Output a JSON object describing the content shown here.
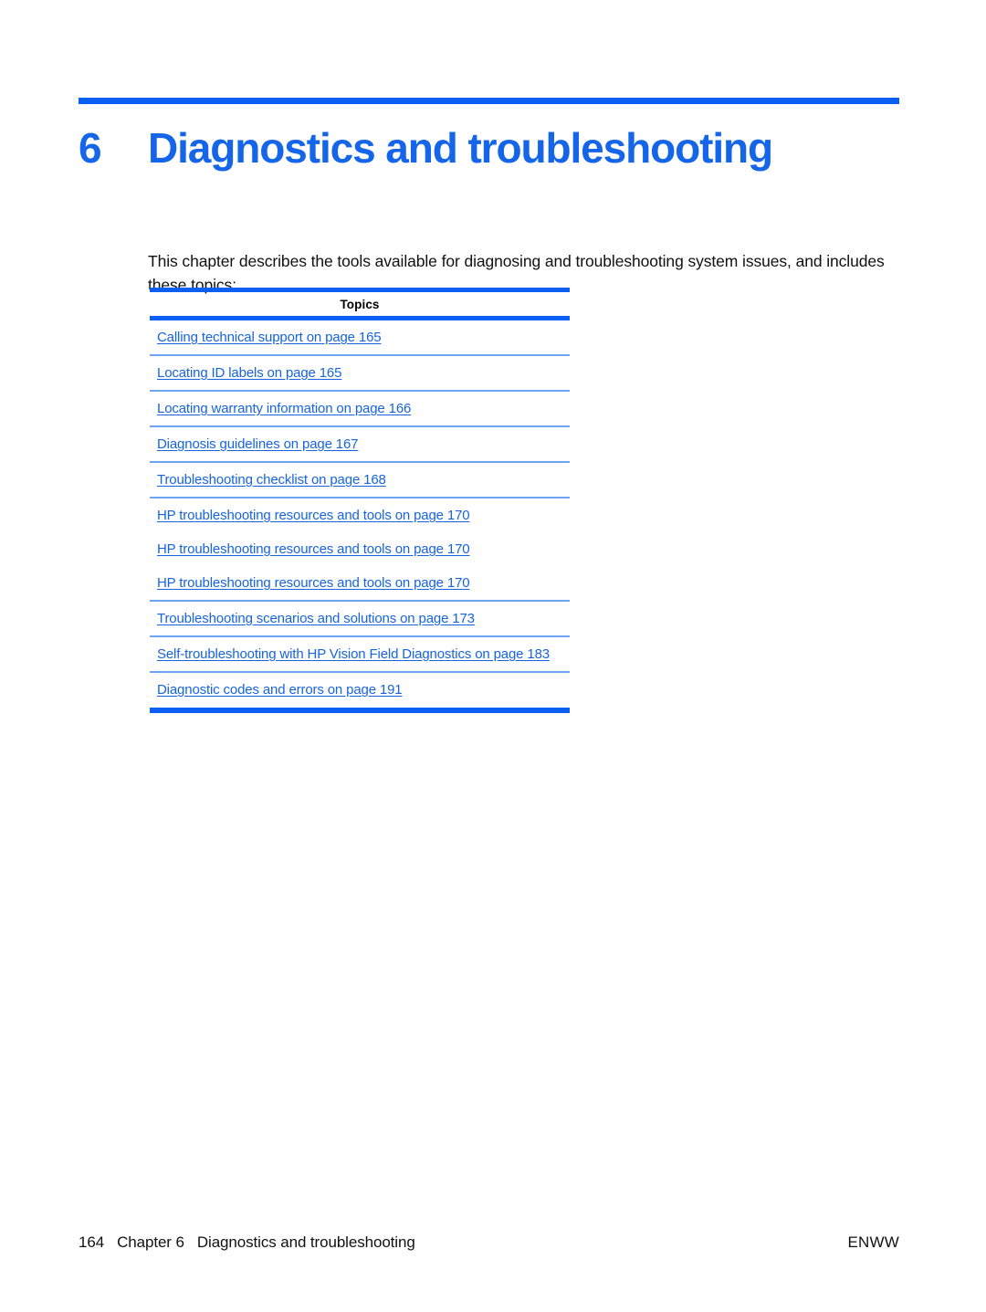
{
  "document": {
    "chapter_number": "6",
    "chapter_title": "Diagnostics and troubleshooting",
    "intro": "This chapter describes the tools available for diagnosing and troubleshooting system issues, and includes these topics:",
    "accent_color": "#0A5FF5",
    "heading_color": "#1565E8",
    "link_color": "#1764E0",
    "rule_light_color": "#6FA4F2"
  },
  "topics_table": {
    "header": "Topics",
    "rows": [
      {
        "label": "Calling technical support on page 165",
        "separator": true
      },
      {
        "label": "Locating ID labels on page 165",
        "separator": true
      },
      {
        "label": "Locating warranty information on page 166",
        "separator": true
      },
      {
        "label": "Diagnosis guidelines on page 167",
        "separator": true
      },
      {
        "label": "Troubleshooting checklist on page 168",
        "separator": true
      },
      {
        "label": "HP troubleshooting resources and tools on page 170",
        "separator": false
      },
      {
        "label": "HP troubleshooting resources and tools on page 170",
        "separator": false
      },
      {
        "label": "HP troubleshooting resources and tools on page 170",
        "separator": true
      },
      {
        "label": "Troubleshooting scenarios and solutions on page 173",
        "separator": true
      },
      {
        "label": "Self-troubleshooting with HP Vision Field Diagnostics on page 183",
        "separator": true
      },
      {
        "label": "Diagnostic codes and errors on page 191",
        "separator": false
      }
    ]
  },
  "footer": {
    "page_number": "164",
    "chapter_label": "Chapter 6",
    "chapter_title": "Diagnostics and troubleshooting",
    "locale_code": "ENWW"
  }
}
